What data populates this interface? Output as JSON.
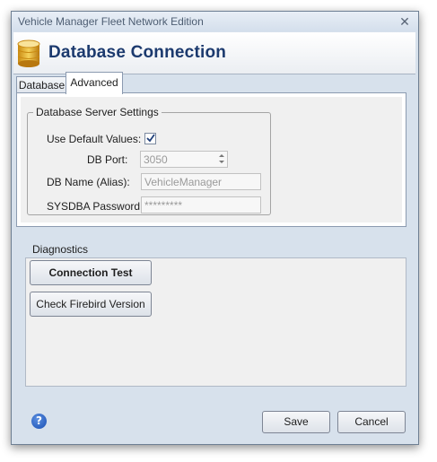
{
  "window": {
    "title": "Vehicle Manager Fleet Network Edition",
    "close_glyph": "✕"
  },
  "header": {
    "title": "Database Connection",
    "icon": "database-icon"
  },
  "tabs": [
    {
      "label": "Database",
      "active": false
    },
    {
      "label": "Advanced",
      "active": true
    }
  ],
  "server_settings": {
    "legend": "Database Server Settings",
    "use_default_label": "Use Default Values:",
    "use_default_checked": true,
    "db_port_label": "DB Port:",
    "db_port_value": "3050",
    "db_name_label": "DB Name (Alias):",
    "db_name_value": "VehicleManager",
    "password_label": "SYSDBA Password:",
    "password_value": "*********"
  },
  "diagnostics": {
    "label": "Diagnostics",
    "connection_test": "Connection Test",
    "check_firebird": "Check Firebird Version"
  },
  "footer": {
    "help_glyph": "?",
    "save": "Save",
    "cancel": "Cancel"
  },
  "colors": {
    "header_title": "#1c3a6e",
    "window_bg": "#d7e1ec",
    "panel_bg": "#f0f0f0"
  }
}
